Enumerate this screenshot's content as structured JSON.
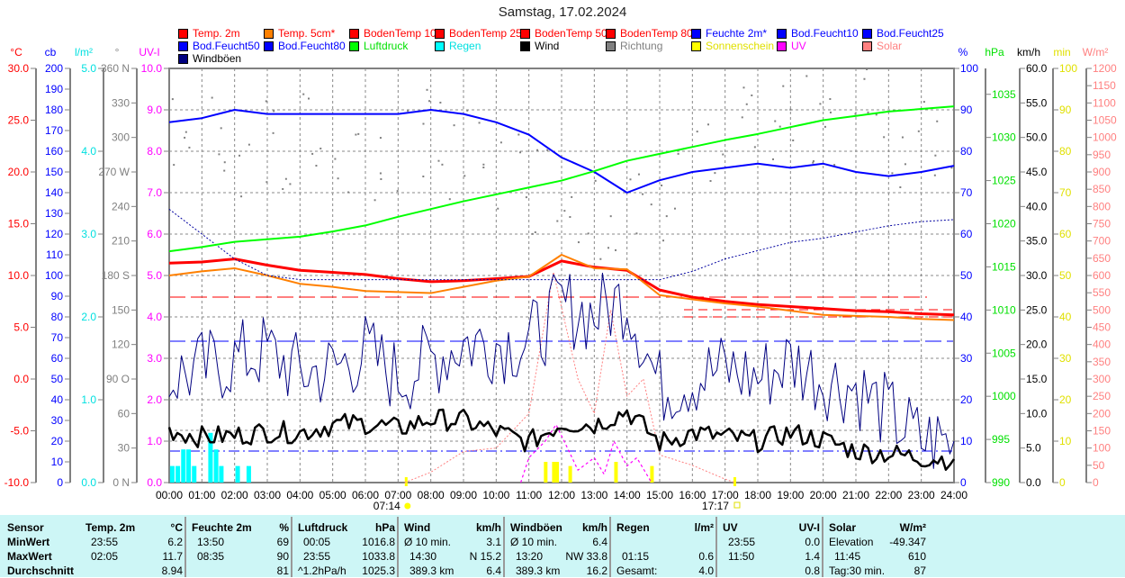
{
  "title": "Samstag, 17.02.2024",
  "legend": [
    {
      "label": "Temp. 2m",
      "color": "#ff0000",
      "text": "#ff0000"
    },
    {
      "label": "Temp. 5cm*",
      "color": "#ff8000",
      "text": "#ff0000"
    },
    {
      "label": "BodenTemp 10",
      "color": "#ff0000",
      "text": "#ff0000"
    },
    {
      "label": "BodenTemp 25",
      "color": "#ff0000",
      "text": "#ff0000"
    },
    {
      "label": "BodenTemp 50",
      "color": "#ff0000",
      "text": "#ff0000"
    },
    {
      "label": "BodenTemp 80",
      "color": "#ff0000",
      "text": "#ff0000"
    },
    {
      "label": "Feuchte 2m*",
      "color": "#0000ff",
      "text": "#0000ff"
    },
    {
      "label": "Bod.Feucht10",
      "color": "#0000ff",
      "text": "#0000ff"
    },
    {
      "label": "Bod.Feucht25",
      "color": "#0000ff",
      "text": "#0000ff"
    },
    {
      "label": "Bod.Feucht50",
      "color": "#0000ff",
      "text": "#0000ff"
    },
    {
      "label": "Bod.Feucht80",
      "color": "#0000ff",
      "text": "#0000ff"
    },
    {
      "label": "Luftdruck",
      "color": "#00ff00",
      "text": "#00e000"
    },
    {
      "label": "Regen",
      "color": "#00ffff",
      "text": "#00e0e0"
    },
    {
      "label": "Wind",
      "color": "#000000",
      "text": "#000000"
    },
    {
      "label": "Richtung",
      "color": "#808080",
      "text": "#808080"
    },
    {
      "label": "Sonnenschein",
      "color": "#ffff00",
      "text": "#e0e000"
    },
    {
      "label": "UV",
      "color": "#ff00ff",
      "text": "#ff00ff"
    },
    {
      "label": "Solar",
      "color": "#ff8080",
      "text": "#ff8080"
    },
    {
      "label": "Windböen",
      "color": "#000080",
      "text": "#000000"
    }
  ],
  "chart_data": {
    "type": "line",
    "title": "Samstag, 17.02.2024",
    "x_labels": [
      "00:00",
      "01:00",
      "02:00",
      "03:00",
      "04:00",
      "05:00",
      "06:00",
      "07:00",
      "08:00",
      "09:00",
      "10:00",
      "11:00",
      "12:00",
      "13:00",
      "14:00",
      "15:00",
      "16:00",
      "17:00",
      "18:00",
      "19:00",
      "20:00",
      "21:00",
      "22:00",
      "23:00",
      "24:00"
    ],
    "sunrise": "07:14",
    "sunset": "17:17",
    "axes_left": [
      {
        "id": "temp",
        "unit": "°C",
        "color": "#ff0000",
        "first": 30,
        "step": 5,
        "min": -10,
        "max": 30,
        "labels": [
          "30.0",
          "25.0",
          "20.0",
          "15.0",
          "10.0",
          "5.0",
          "0.0",
          "-5.0",
          "-10.0"
        ]
      },
      {
        "id": "cb",
        "unit": "cb",
        "color": "#0000ff",
        "first": 200,
        "step": 10,
        "min": 0,
        "max": 200,
        "labels": [
          "200",
          "190",
          "180",
          "170",
          "160",
          "150",
          "140",
          "130",
          "120",
          "110",
          "100",
          "90",
          "80",
          "70",
          "60",
          "50",
          "40",
          "30",
          "20",
          "10",
          "0"
        ]
      },
      {
        "id": "rain",
        "unit": "l/m²",
        "color": "#00e0e0",
        "first": 5,
        "step": 1,
        "min": 0,
        "max": 5,
        "labels": [
          "5.0",
          "4.0",
          "3.0",
          "2.0",
          "1.0",
          "0.0"
        ]
      },
      {
        "id": "dir",
        "unit": "°",
        "color": "#808080",
        "first": 360,
        "step": 30,
        "min": 0,
        "max": 360,
        "labels": [
          "360 N",
          "330",
          "300",
          "270 W",
          "240",
          "210",
          "180 S",
          "150",
          "120",
          "90 O",
          "60",
          "30",
          "0 N"
        ]
      },
      {
        "id": "uv",
        "unit": "UV-I",
        "color": "#ff00ff",
        "first": 10,
        "step": 1,
        "min": 0,
        "max": 10,
        "labels": [
          "10.0",
          "9.0",
          "8.0",
          "7.0",
          "6.0",
          "5.0",
          "4.0",
          "3.0",
          "2.0",
          "1.0",
          "0.0"
        ]
      }
    ],
    "axes_right": [
      {
        "id": "hum",
        "unit": "%",
        "color": "#0000ff",
        "first": 100,
        "step": 10,
        "min": 0,
        "max": 100,
        "labels": [
          "100",
          "90",
          "80",
          "70",
          "60",
          "50",
          "40",
          "30",
          "20",
          "10",
          "0"
        ]
      },
      {
        "id": "hpa",
        "unit": "hPa",
        "color": "#00e000",
        "first": 1035,
        "step": 5,
        "min": 990,
        "max": 1038,
        "labels": [
          "1035",
          "1030",
          "1025",
          "1020",
          "1015",
          "1010",
          "1005",
          "1000",
          "995",
          "990"
        ]
      },
      {
        "id": "kmh",
        "unit": "km/h",
        "color": "#000000",
        "first": 60,
        "step": 5,
        "min": 0,
        "max": 60,
        "labels": [
          "60.0",
          "55.0",
          "50.0",
          "45.0",
          "40.0",
          "35.0",
          "30.0",
          "25.0",
          "20.0",
          "15.0",
          "10.0",
          "5.0",
          "0.0"
        ]
      },
      {
        "id": "min",
        "unit": "min",
        "color": "#e0e000",
        "first": 100,
        "step": 10,
        "min": 0,
        "max": 100,
        "labels": [
          "100",
          "90",
          "80",
          "70",
          "60",
          "50",
          "40",
          "30",
          "20",
          "10",
          "0"
        ]
      },
      {
        "id": "wm2",
        "unit": "W/m²",
        "color": "#ff8080",
        "first": 1200,
        "step": 50,
        "min": 0,
        "max": 1200,
        "labels": [
          "1200",
          "1150",
          "1100",
          "1050",
          "1000",
          "950",
          "900",
          "850",
          "800",
          "750",
          "700",
          "650",
          "600",
          "550",
          "500",
          "450",
          "400",
          "350",
          "300",
          "250",
          "200",
          "150",
          "100",
          "50",
          "0"
        ]
      }
    ],
    "series": [
      {
        "name": "Temp. 2m",
        "axis": "temp",
        "color": "#ff0000",
        "width": 3,
        "values": [
          11.2,
          11.3,
          11.6,
          11.0,
          10.5,
          10.3,
          10.1,
          9.7,
          9.4,
          9.5,
          9.7,
          9.9,
          11.4,
          10.8,
          10.5,
          8.6,
          7.9,
          7.5,
          7.2,
          7.0,
          6.8,
          6.6,
          6.5,
          6.3,
          6.2
        ]
      },
      {
        "name": "Temp. 5cm*",
        "axis": "temp",
        "color": "#ff8000",
        "width": 2,
        "values": [
          10.0,
          10.4,
          10.7,
          10.0,
          9.2,
          8.9,
          8.5,
          8.4,
          8.3,
          8.9,
          9.5,
          9.9,
          12.0,
          10.7,
          10.6,
          8.1,
          7.7,
          7.3,
          7.0,
          6.6,
          6.2,
          6.1,
          6.0,
          5.8,
          5.7
        ]
      },
      {
        "name": "Feuchte 2m*",
        "axis": "hum",
        "color": "#0000ff",
        "width": 2,
        "values": [
          87,
          88,
          90,
          89,
          89,
          89,
          89,
          89,
          90,
          89,
          87,
          84,
          78.5,
          75,
          70,
          73,
          75,
          76,
          77,
          76,
          77,
          75,
          74,
          75,
          76.5
        ]
      },
      {
        "name": "Bod.Feucht10",
        "axis": "cb",
        "color": "#0000a0",
        "width": 1,
        "dash": "2,2",
        "values": [
          132,
          120,
          108,
          100,
          98,
          98,
          98,
          98,
          98,
          98,
          98,
          98,
          98,
          98,
          98,
          98,
          102,
          108,
          112,
          116,
          118,
          121,
          124,
          126,
          127
        ]
      },
      {
        "name": "Luftdruck",
        "axis": "hpa",
        "color": "#00ff00",
        "width": 2,
        "values": [
          1016.8,
          1017.3,
          1017.9,
          1018.2,
          1018.5,
          1019.1,
          1019.8,
          1020.8,
          1021.7,
          1022.6,
          1023.4,
          1024.2,
          1025.0,
          1026.1,
          1027.3,
          1028.1,
          1028.9,
          1029.7,
          1030.4,
          1031.2,
          1032.0,
          1032.5,
          1033.0,
          1033.3,
          1033.6
        ]
      },
      {
        "name": "Windböen",
        "axis": "kmh",
        "color": "#000080",
        "width": 1,
        "jitter": 6,
        "values": [
          15.1,
          16.4,
          17.7,
          19.0,
          15.8,
          16.4,
          19.0,
          15.1,
          17.7,
          20.3,
          20.3,
          20.3,
          25.5,
          24.3,
          26.9,
          13.8,
          15.1,
          16.4,
          15.1,
          17.7,
          15.1,
          13.8,
          9.9,
          6.0,
          6.0
        ]
      },
      {
        "name": "Wind",
        "axis": "kmh",
        "color": "#000000",
        "width": 2.5,
        "jitter": 1.6,
        "values": [
          7.6,
          6.6,
          6.8,
          7.4,
          7.2,
          8.4,
          8.6,
          7.8,
          9.2,
          9.0,
          7.4,
          5.8,
          8.6,
          8.4,
          10.4,
          5.8,
          7.2,
          6.6,
          6.0,
          7.2,
          6.2,
          4.6,
          4.2,
          3.6,
          3.4
        ]
      }
    ],
    "richtung": {
      "axis": "dir",
      "color": "#808080",
      "values": [
        300,
        310,
        290,
        280,
        300,
        290,
        270,
        300,
        290,
        280,
        270,
        260,
        250,
        240,
        230,
        250,
        270,
        300,
        320,
        310,
        320,
        330,
        300,
        310,
        320
      ]
    },
    "solar": {
      "axis": "wm2",
      "color": "#ff8080",
      "points": [
        [
          7.2,
          0
        ],
        [
          8,
          30
        ],
        [
          9,
          90
        ],
        [
          10,
          100
        ],
        [
          11,
          200
        ],
        [
          11.75,
          610
        ],
        [
          12.5,
          300
        ],
        [
          13,
          200
        ],
        [
          13.5,
          500
        ],
        [
          14,
          250
        ],
        [
          14.5,
          300
        ],
        [
          15,
          80
        ],
        [
          16,
          50
        ],
        [
          17,
          10
        ],
        [
          17.3,
          0
        ]
      ]
    },
    "uv": {
      "axis": "uv",
      "color": "#ff00ff",
      "points": [
        [
          10.75,
          0
        ],
        [
          11,
          0.6
        ],
        [
          11.5,
          1.0
        ],
        [
          11.83,
          1.4
        ],
        [
          12.2,
          0.8
        ],
        [
          12.5,
          0.3
        ],
        [
          13,
          0.6
        ],
        [
          13.3,
          0.2
        ],
        [
          13.6,
          1.0
        ],
        [
          14,
          0.4
        ],
        [
          14.3,
          0.6
        ],
        [
          14.75,
          0
        ]
      ]
    },
    "regen": {
      "axis": "rain",
      "color": "#00ffff",
      "points": [
        [
          0.08,
          0.2
        ],
        [
          0.25,
          0.2
        ],
        [
          0.42,
          0.4
        ],
        [
          0.58,
          0.4
        ],
        [
          0.75,
          0.2
        ],
        [
          1.25,
          0.6
        ],
        [
          1.42,
          0.4
        ],
        [
          1.58,
          0.2
        ],
        [
          2.08,
          0.2
        ],
        [
          2.42,
          0.2
        ]
      ]
    },
    "sonnenschein": {
      "axis": "min",
      "color": "#ffff00",
      "points": [
        [
          11.5,
          5
        ],
        [
          11.75,
          5
        ],
        [
          11.85,
          5
        ],
        [
          12.25,
          4
        ],
        [
          13.65,
          5
        ],
        [
          14.75,
          4
        ]
      ]
    }
  },
  "table": {
    "row_labels": [
      "Sensor",
      "MinWert",
      "MaxWert",
      "Durchschnitt"
    ],
    "sections": [
      {
        "title": "Temp. 2m",
        "unit": "°C",
        "rows": [
          [
            "23:55",
            "6.2"
          ],
          [
            "02:05",
            "11.7"
          ],
          [
            "",
            "8.94"
          ]
        ]
      },
      {
        "title": "Feuchte 2m",
        "unit": "%",
        "rows": [
          [
            "13:50",
            "69"
          ],
          [
            "08:35",
            "90"
          ],
          [
            "",
            "81"
          ]
        ]
      },
      {
        "title": "Luftdruck",
        "unit": "hPa",
        "rows": [
          [
            "00:05",
            "1016.8"
          ],
          [
            "23:55",
            "1033.8"
          ],
          [
            "^1.2hPa/h",
            "1025.3"
          ]
        ]
      },
      {
        "title": "Wind",
        "unit": "km/h",
        "rows": [
          [
            "Ø 10 min.",
            "3.1"
          ],
          [
            "14:30",
            "N 15.2"
          ],
          [
            "389.3 km",
            "6.4"
          ]
        ]
      },
      {
        "title": "Windböen",
        "unit": "km/h",
        "rows": [
          [
            "Ø 10 min.",
            "6.4"
          ],
          [
            "13:20",
            "NW 33.8"
          ],
          [
            "389.3 km",
            "16.2"
          ]
        ]
      },
      {
        "title": "Regen",
        "unit": "l/m²",
        "rows": [
          [
            "",
            ""
          ],
          [
            "01:15",
            "0.6"
          ],
          [
            "Gesamt:",
            "4.0"
          ]
        ]
      },
      {
        "title": "UV",
        "unit": "UV-I",
        "rows": [
          [
            "23:55",
            "0.0"
          ],
          [
            "11:50",
            "1.4"
          ],
          [
            "",
            "0.8"
          ]
        ]
      },
      {
        "title": "Solar",
        "unit": "W/m²",
        "rows": [
          [
            "Elevation",
            "-49.347"
          ],
          [
            "11:45",
            "610"
          ],
          [
            "Tag:30 min.",
            "87"
          ]
        ]
      }
    ]
  }
}
